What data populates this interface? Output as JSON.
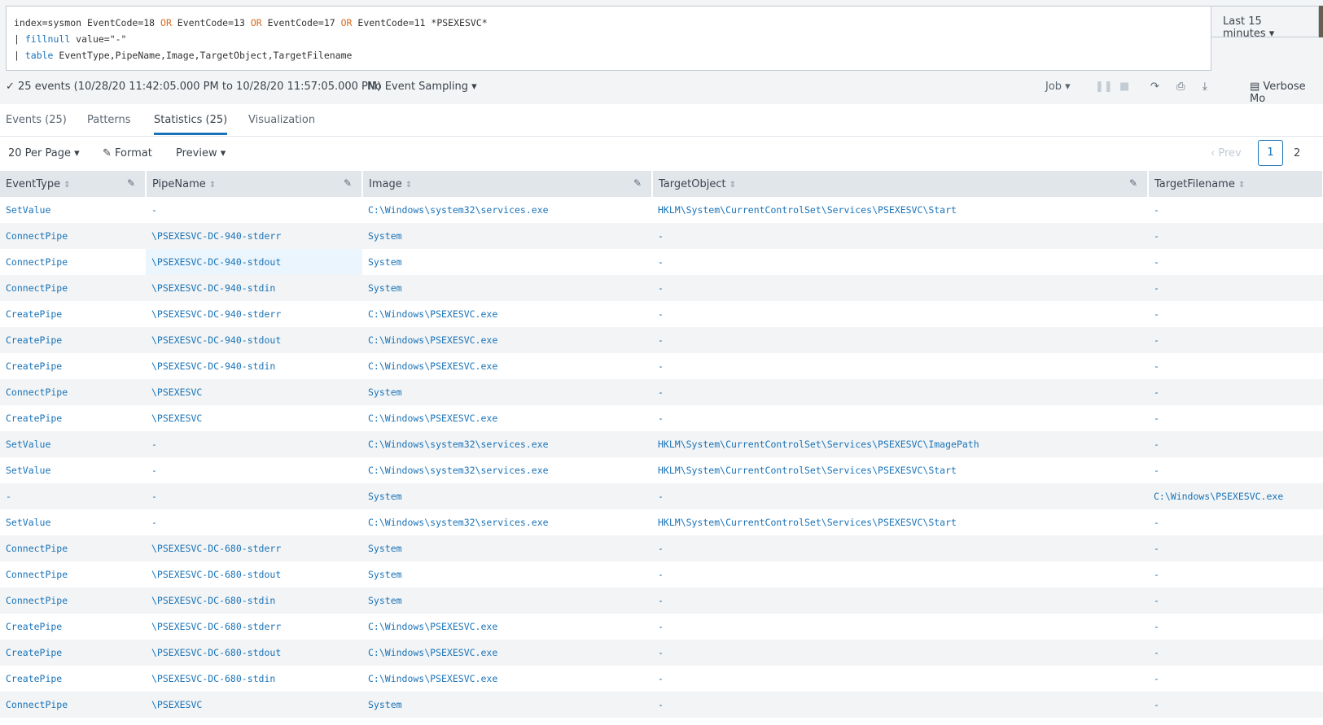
{
  "search": {
    "line1": [
      {
        "t": "index=sysmon EventCode=18 ",
        "c": ""
      },
      {
        "t": "OR",
        "c": "kw"
      },
      {
        "t": " EventCode=13 ",
        "c": ""
      },
      {
        "t": "OR",
        "c": "kw"
      },
      {
        "t": " EventCode=17 ",
        "c": ""
      },
      {
        "t": "OR",
        "c": "kw"
      },
      {
        "t": " EventCode=11 *PSEXESVC*",
        "c": ""
      }
    ],
    "line2_pipe": "| ",
    "line2_cmd": "fillnull",
    "line2_rest": " value=\"-\"",
    "line3_pipe": "| ",
    "line3_cmd": "table",
    "line3_rest": " EventType,PipeName,Image,TargetObject,TargetFilename",
    "time_range": "Last 15 minutes ▾"
  },
  "status": {
    "text": "✓ 25 events (10/28/20 11:42:05.000 PM to 10/28/20 11:57:05.000 PM)",
    "sampling": "No Event Sampling ▾",
    "job": "Job ▾",
    "mode": "Verbose Mo"
  },
  "tabs": [
    {
      "label": "Events (25)"
    },
    {
      "label": "Patterns"
    },
    {
      "label": "Statistics (25)",
      "active": true
    },
    {
      "label": "Visualization"
    }
  ],
  "controls": {
    "per_page": "20 Per Page ▾",
    "format": "Format",
    "preview": "Preview ▾",
    "prev": "‹ Prev",
    "page_current": "1",
    "page_next": "2"
  },
  "table": {
    "columns": [
      "EventType",
      "PipeName",
      "Image",
      "TargetObject",
      "TargetFilename"
    ],
    "rows": [
      [
        "SetValue",
        "-",
        "C:\\Windows\\system32\\services.exe",
        "HKLM\\System\\CurrentControlSet\\Services\\PSEXESVC\\Start",
        "-"
      ],
      [
        "ConnectPipe",
        "\\PSEXESVC-DC-940-stderr",
        "System",
        "-",
        "-"
      ],
      [
        "ConnectPipe",
        "\\PSEXESVC-DC-940-stdout",
        "System",
        "-",
        "-"
      ],
      [
        "ConnectPipe",
        "\\PSEXESVC-DC-940-stdin",
        "System",
        "-",
        "-"
      ],
      [
        "CreatePipe",
        "\\PSEXESVC-DC-940-stderr",
        "C:\\Windows\\PSEXESVC.exe",
        "-",
        "-"
      ],
      [
        "CreatePipe",
        "\\PSEXESVC-DC-940-stdout",
        "C:\\Windows\\PSEXESVC.exe",
        "-",
        "-"
      ],
      [
        "CreatePipe",
        "\\PSEXESVC-DC-940-stdin",
        "C:\\Windows\\PSEXESVC.exe",
        "-",
        "-"
      ],
      [
        "ConnectPipe",
        "\\PSEXESVC",
        "System",
        "-",
        "-"
      ],
      [
        "CreatePipe",
        "\\PSEXESVC",
        "C:\\Windows\\PSEXESVC.exe",
        "-",
        "-"
      ],
      [
        "SetValue",
        "-",
        "C:\\Windows\\system32\\services.exe",
        "HKLM\\System\\CurrentControlSet\\Services\\PSEXESVC\\ImagePath",
        "-"
      ],
      [
        "SetValue",
        "-",
        "C:\\Windows\\system32\\services.exe",
        "HKLM\\System\\CurrentControlSet\\Services\\PSEXESVC\\Start",
        "-"
      ],
      [
        "-",
        "-",
        "System",
        "-",
        "C:\\Windows\\PSEXESVC.exe"
      ],
      [
        "SetValue",
        "-",
        "C:\\Windows\\system32\\services.exe",
        "HKLM\\System\\CurrentControlSet\\Services\\PSEXESVC\\Start",
        "-"
      ],
      [
        "ConnectPipe",
        "\\PSEXESVC-DC-680-stderr",
        "System",
        "-",
        "-"
      ],
      [
        "ConnectPipe",
        "\\PSEXESVC-DC-680-stdout",
        "System",
        "-",
        "-"
      ],
      [
        "ConnectPipe",
        "\\PSEXESVC-DC-680-stdin",
        "System",
        "-",
        "-"
      ],
      [
        "CreatePipe",
        "\\PSEXESVC-DC-680-stderr",
        "C:\\Windows\\PSEXESVC.exe",
        "-",
        "-"
      ],
      [
        "CreatePipe",
        "\\PSEXESVC-DC-680-stdout",
        "C:\\Windows\\PSEXESVC.exe",
        "-",
        "-"
      ],
      [
        "CreatePipe",
        "\\PSEXESVC-DC-680-stdin",
        "C:\\Windows\\PSEXESVC.exe",
        "-",
        "-"
      ],
      [
        "ConnectPipe",
        "\\PSEXESVC",
        "System",
        "-",
        "-"
      ]
    ]
  }
}
